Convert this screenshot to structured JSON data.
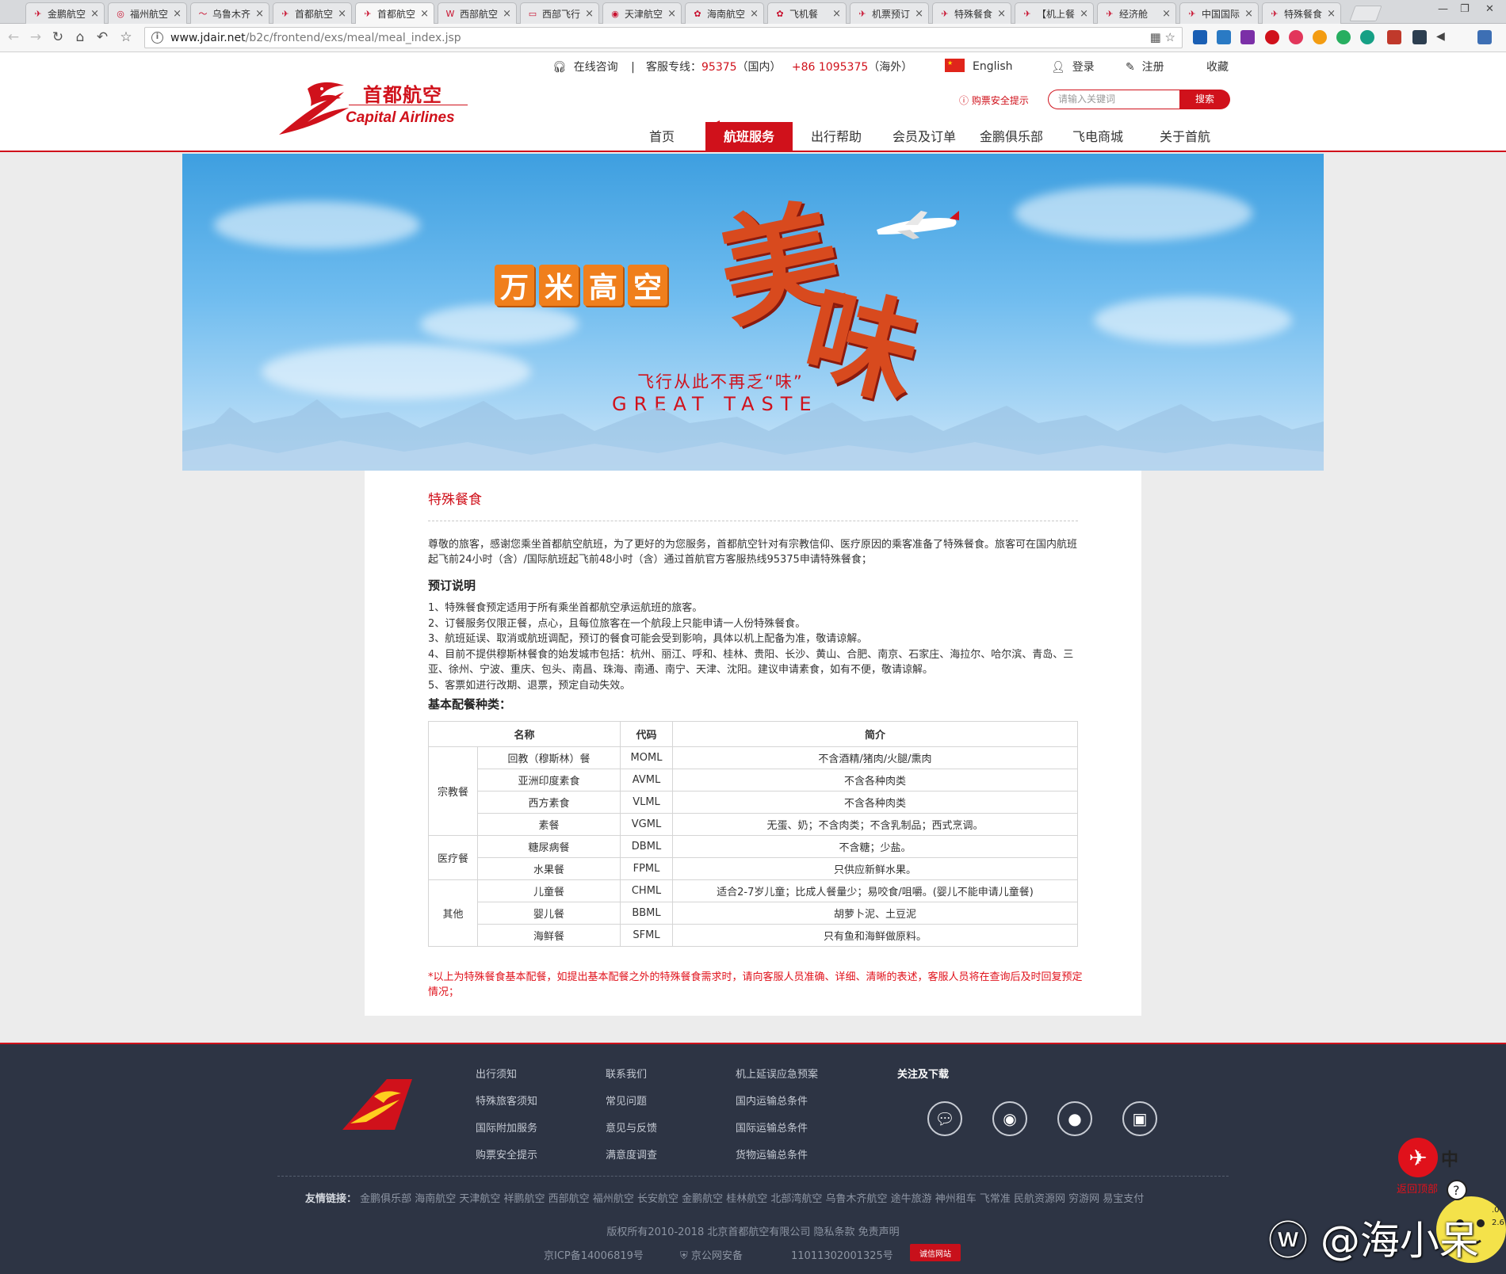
{
  "browser": {
    "tabs": [
      {
        "label": "金鹏航空",
        "active": false
      },
      {
        "label": "福州航空",
        "active": false
      },
      {
        "label": "乌鲁木齐",
        "active": false
      },
      {
        "label": "首都航空",
        "active": false
      },
      {
        "label": "首都航空",
        "active": true
      },
      {
        "label": "西部航空",
        "active": false
      },
      {
        "label": "西部飞行",
        "active": false
      },
      {
        "label": "天津航空",
        "active": false
      },
      {
        "label": "海南航空",
        "active": false
      },
      {
        "label": "飞机餐",
        "active": false
      },
      {
        "label": "机票预订",
        "active": false
      },
      {
        "label": "特殊餐食",
        "active": false
      },
      {
        "label": "【机上餐",
        "active": false
      },
      {
        "label": "经济舱",
        "active": false
      },
      {
        "label": "中国国际",
        "active": false
      },
      {
        "label": "特殊餐食",
        "active": false
      }
    ],
    "close_glyph": "×",
    "url_host": "www.jdair.net",
    "url_path": "/b2c/frontend/exs/meal/meal_index.jsp"
  },
  "header": {
    "logo_cn": "首都航空",
    "logo_en": "Capital Airlines",
    "online_consult": "在线咨询",
    "divider": "|",
    "hotline_label": "客服专线：",
    "hotline_cn": "95375",
    "hotline_cn_region": "（国内）",
    "hotline_intl": "+86 1095375",
    "hotline_intl_region": "（海外）",
    "lang": "English",
    "login": "登录",
    "register": "注册",
    "favorite": "收藏",
    "safety_tip": "购票安全提示",
    "search_placeholder": "请输入关键词",
    "search_btn": "搜索",
    "nav": [
      "首页",
      "航班服务",
      "出行帮助",
      "会员及订单",
      "金鹏俱乐部",
      "飞电商城",
      "关于首航"
    ]
  },
  "banner": {
    "chars": [
      "万",
      "米",
      "高",
      "空"
    ],
    "big1": "美",
    "big2": "味",
    "slogan": "飞行从此不再乏“味”",
    "en": "GREAT TASTE"
  },
  "content": {
    "title": "特殊餐食",
    "intro": "尊敬的旅客，感谢您乘坐首都航空航班，为了更好的为您服务，首都航空针对有宗教信仰、医疗原因的乘客准备了特殊餐食。旅客可在国内航班起飞前24小时（含）/国际航班起飞前48小时（含）通过首航官方客服热线95375申请特殊餐食；",
    "booking_heading": "预订说明",
    "booking_items": [
      "1、特殊餐食预定适用于所有乘坐首都航空承运航班的旅客。",
      "2、订餐服务仅限正餐，点心，且每位旅客在一个航段上只能申请一人份特殊餐食。",
      "3、航班延误、取消或航班调配，预订的餐食可能会受到影响，具体以机上配备为准，敬请谅解。",
      "4、目前不提供穆斯林餐食的始发城市包括：杭州、丽江、呼和、桂林、贵阳、长沙、黄山、合肥、南京、石家庄、海拉尔、哈尔滨、青岛、三亚、徐州、宁波、重庆、包头、南昌、珠海、南通、南宁、天津、沈阳。建议申请素食，如有不便，敬请谅解。",
      "5、客票如进行改期、退票，预定自动失效。"
    ],
    "types_heading": "基本配餐种类：",
    "table_headers": [
      "名称",
      "代码",
      "简介"
    ],
    "groups": [
      {
        "category": "宗教餐",
        "rows": [
          {
            "name": "回教（穆斯林）餐",
            "code": "MOML",
            "desc": "不含酒精/猪肉/火腿/熏肉"
          },
          {
            "name": "亚洲印度素食",
            "code": "AVML",
            "desc": "不含各种肉类"
          },
          {
            "name": "西方素食",
            "code": "VLML",
            "desc": "不含各种肉类"
          },
          {
            "name": "素餐",
            "code": "VGML",
            "desc": "无蛋、奶；不含肉类；不含乳制品；西式烹调。"
          }
        ]
      },
      {
        "category": "医疗餐",
        "rows": [
          {
            "name": "糖尿病餐",
            "code": "DBML",
            "desc": "不含糖；少盐。"
          },
          {
            "name": "水果餐",
            "code": "FPML",
            "desc": "只供应新鲜水果。"
          }
        ]
      },
      {
        "category": "其他",
        "rows": [
          {
            "name": "儿童餐",
            "code": "CHML",
            "desc": "适合2-7岁儿童；比成人餐量少；易咬食/咀嚼。(婴儿不能申请儿童餐)"
          },
          {
            "name": "婴儿餐",
            "code": "BBML",
            "desc": "胡萝卜泥、土豆泥"
          },
          {
            "name": "海鲜餐",
            "code": "SFML",
            "desc": "只有鱼和海鲜做原料。"
          }
        ]
      }
    ],
    "note": "*以上为特殊餐食基本配餐，如提出基本配餐之外的特殊餐食需求时，请向客服人员准确、详细、清晰的表述，客服人员将在查询后及时回复预定情况；"
  },
  "footer": {
    "col1": [
      "出行须知",
      "特殊旅客须知",
      "国际附加服务",
      "购票安全提示"
    ],
    "col2": [
      "联系我们",
      "常见问题",
      "意见与反馈",
      "满意度调查"
    ],
    "col3": [
      "机上延误应急预案",
      "国内运输总条件",
      "国际运输总条件",
      "货物运输总条件"
    ],
    "follow_title": "关注及下载",
    "links_label": "友情链接：",
    "links": "金鹏俱乐部 海南航空 天津航空 祥鹏航空 西部航空 福州航空 长安航空 金鹏航空 桂林航空 北部湾航空 乌鲁木齐航空 途牛旅游 神州租车 飞常准 民航资源网 穷游网 易宝支付",
    "copyright": "版权所有2010-2018 北京首都航空有限公司 隐私条款 免责声明",
    "icp": "京ICP备14006819号",
    "police": "京公网安备",
    "police_no": "11011302001325号",
    "gov_badge": "诚信网站"
  },
  "overlay": {
    "zh": "中",
    "back_top": "返回顶部",
    "watermark": "@海小呆",
    "mini1": ".0",
    "mini2": "2.6"
  },
  "colors": {
    "brand_red": "#d0111b",
    "footer_bg": "#2d3444",
    "banner_orange": "#f07f1c"
  }
}
